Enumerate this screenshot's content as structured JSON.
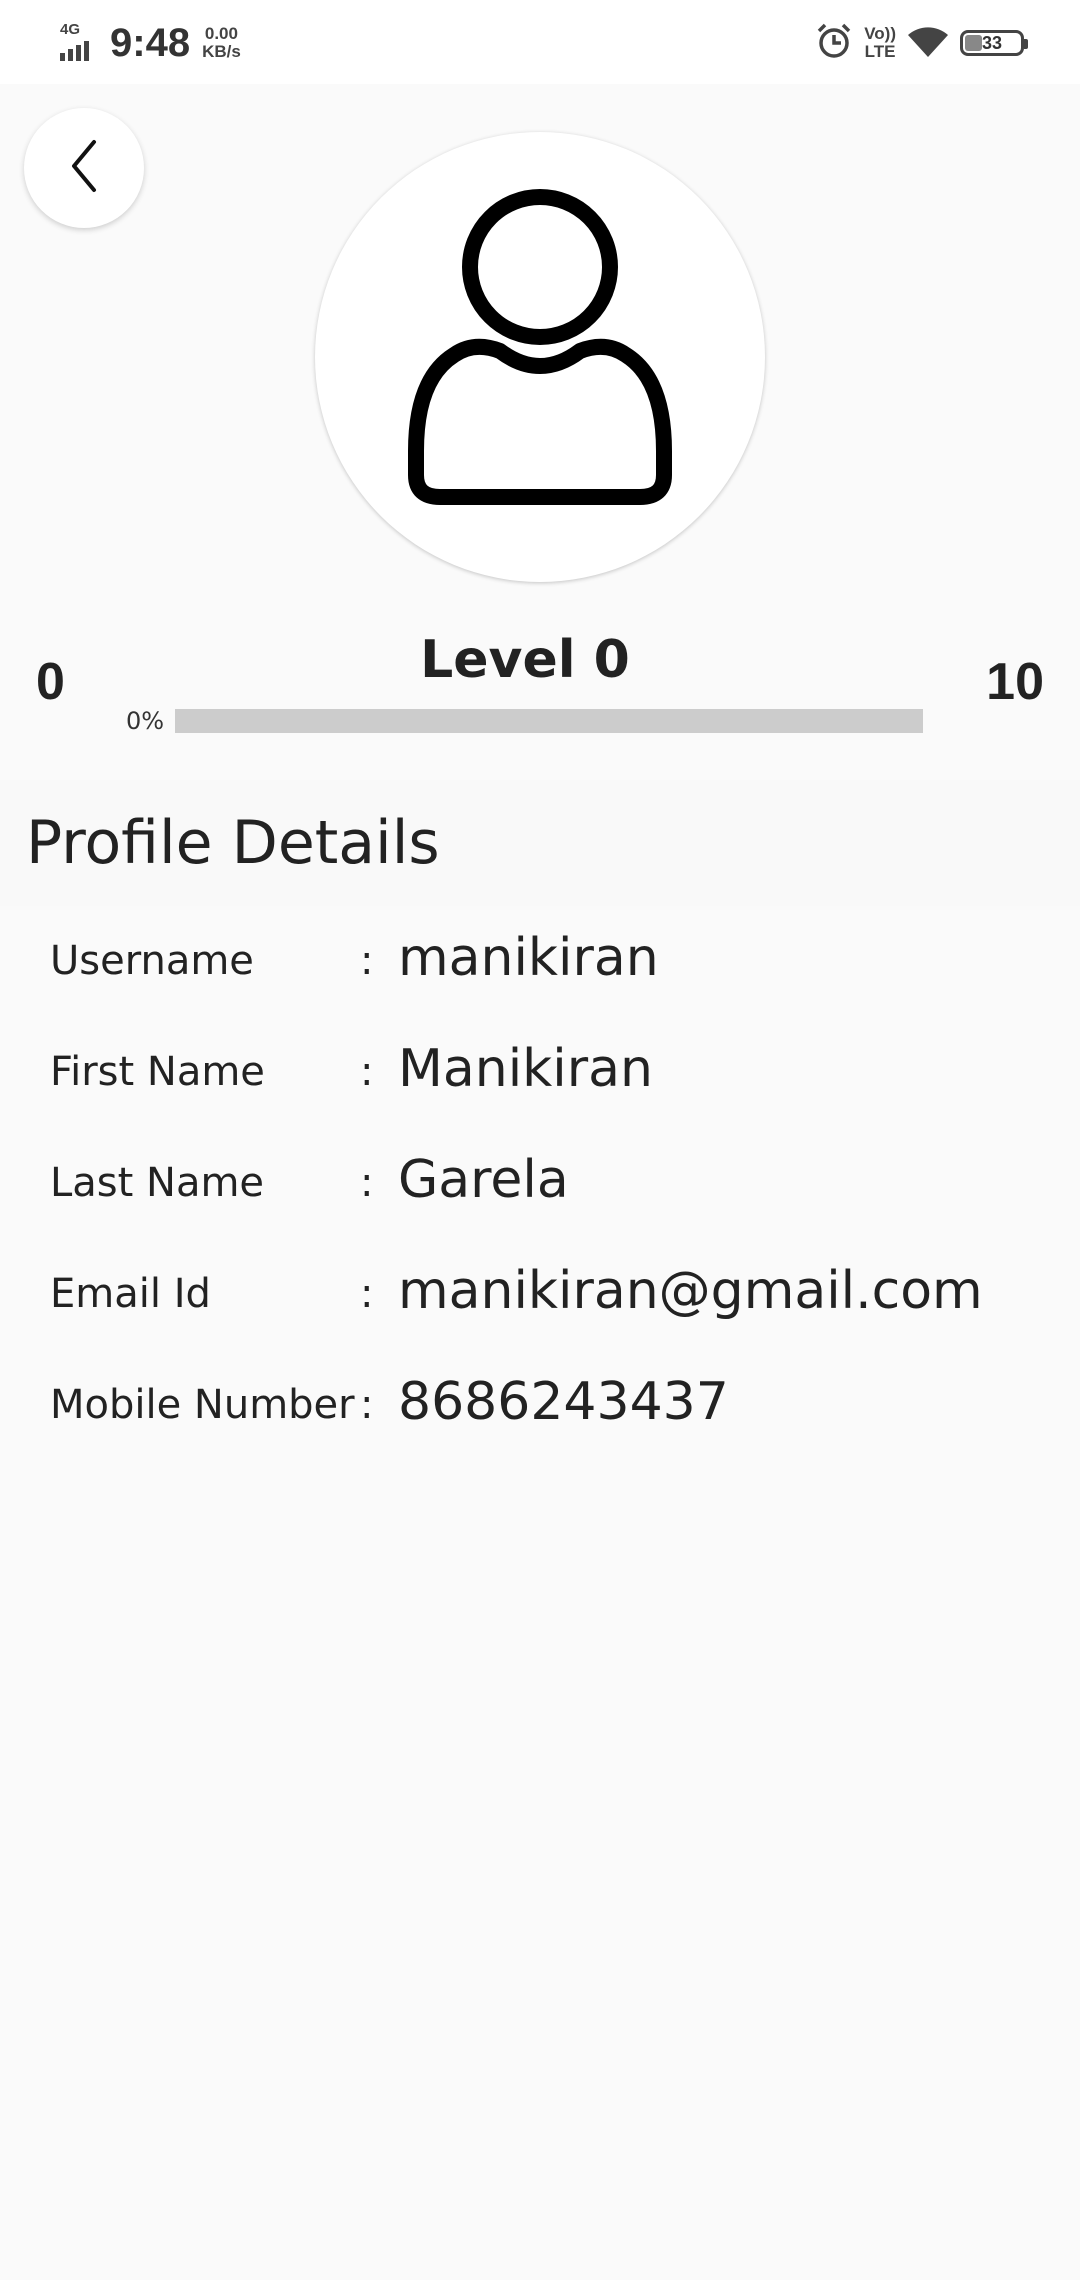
{
  "status_bar": {
    "network": "4G",
    "time": "9:48",
    "speed_value": "0.00",
    "speed_unit": "KB/s",
    "volte_top": "Vo))",
    "volte_bottom": "LTE",
    "battery": "33",
    "icons": [
      "signal-icon",
      "alarm-icon",
      "volte-icon",
      "wifi-icon",
      "battery-icon"
    ]
  },
  "header": {
    "back_icon": "chevron-left-icon",
    "avatar_icon": "user-icon"
  },
  "level": {
    "min": "0",
    "title": "Level 0",
    "max": "10",
    "percent_label": "0%",
    "progress": 0
  },
  "profile": {
    "title": "Profile Details",
    "separator": ":",
    "fields": [
      {
        "label": "Username",
        "value": "manikiran"
      },
      {
        "label": "First Name",
        "value": "Manikiran"
      },
      {
        "label": "Last Name",
        "value": "Garela"
      },
      {
        "label": "Email Id",
        "value": "manikiran@gmail.com"
      },
      {
        "label": "Mobile Number",
        "value": "8686243437"
      }
    ]
  },
  "colors": {
    "background": "#fafafa",
    "progress_track": "#cccccc",
    "text": "#222222"
  }
}
